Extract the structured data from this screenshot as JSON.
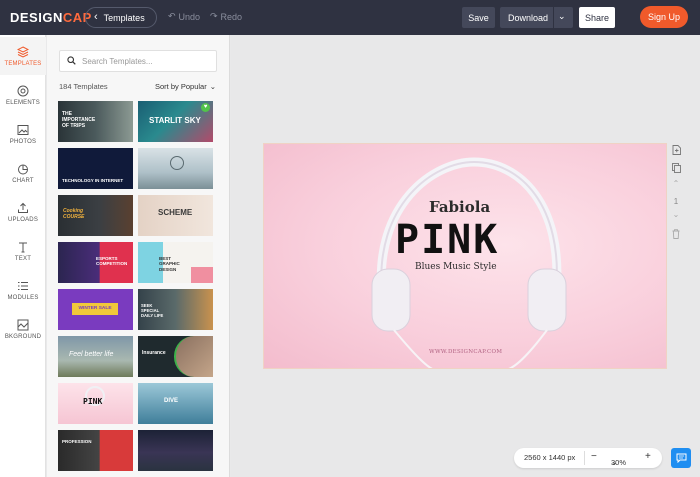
{
  "header": {
    "logo_a": "DESIGN",
    "logo_b": "CAP",
    "templates_label": "Templates",
    "undo_label": "Undo",
    "redo_label": "Redo",
    "save_label": "Save",
    "download_label": "Download",
    "share_label": "Share",
    "signup_label": "Sign Up"
  },
  "rail": {
    "items": [
      {
        "label": "TEMPLATES",
        "icon": "layers-icon"
      },
      {
        "label": "ELEMENTS",
        "icon": "elements-icon"
      },
      {
        "label": "PHOTOS",
        "icon": "photo-icon"
      },
      {
        "label": "CHART",
        "icon": "pie-chart-icon"
      },
      {
        "label": "UPLOADS",
        "icon": "upload-icon"
      },
      {
        "label": "TEXT",
        "icon": "text-icon"
      },
      {
        "label": "MODULES",
        "icon": "list-icon"
      },
      {
        "label": "BKGROUND",
        "icon": "background-icon"
      }
    ]
  },
  "panel": {
    "search_placeholder": "Search Templates...",
    "count_label": "184 Templates",
    "sort_label": "Sort by Popular",
    "thumbnails": [
      {
        "text": "THE IMPORTANCE OF TRIPS"
      },
      {
        "text": "STARLIT SKY"
      },
      {
        "text": "TECHNOLOGY IN INTERNET"
      },
      {
        "text": ""
      },
      {
        "text": "Cooking COURSE"
      },
      {
        "text": "SCHEME"
      },
      {
        "text": "ESPORTS COMPETITION"
      },
      {
        "text": "BEST GRAPHIC DESIGN"
      },
      {
        "text": "WINTER SALE"
      },
      {
        "text": "SEEK SPECIAL DAILY LIFE"
      },
      {
        "text": "Feel better life"
      },
      {
        "text": "Insurance"
      },
      {
        "text": "PINK"
      },
      {
        "text": "DIVE"
      },
      {
        "text": "PROFESSION"
      },
      {
        "text": ""
      }
    ]
  },
  "artboard": {
    "title": "Fabiola",
    "main": "PINK",
    "subtitle": "Blues Music Style",
    "url": "WWW.DESIGNCAP.COM"
  },
  "side_tools": {
    "page_number": "1"
  },
  "zoom": {
    "size_label": "2560 x 1440 px",
    "minus": "−",
    "level": "30%",
    "plus": "+"
  },
  "colors": {
    "accent": "#f05a2b",
    "topbar": "#2f3241",
    "chat": "#1f8ef1"
  }
}
